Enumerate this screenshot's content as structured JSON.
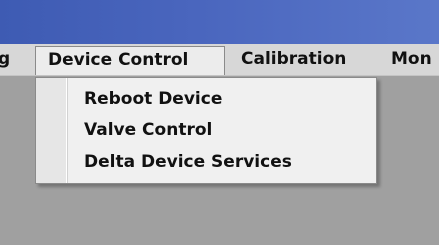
{
  "menubar": {
    "items": [
      {
        "label": "g"
      },
      {
        "label": "Device Control"
      },
      {
        "label": "Calibration"
      },
      {
        "label": "Mon"
      }
    ]
  },
  "dropdown": {
    "items": [
      {
        "label": "Reboot Device"
      },
      {
        "label": "Valve Control"
      },
      {
        "label": "Delta Device Services"
      }
    ]
  }
}
